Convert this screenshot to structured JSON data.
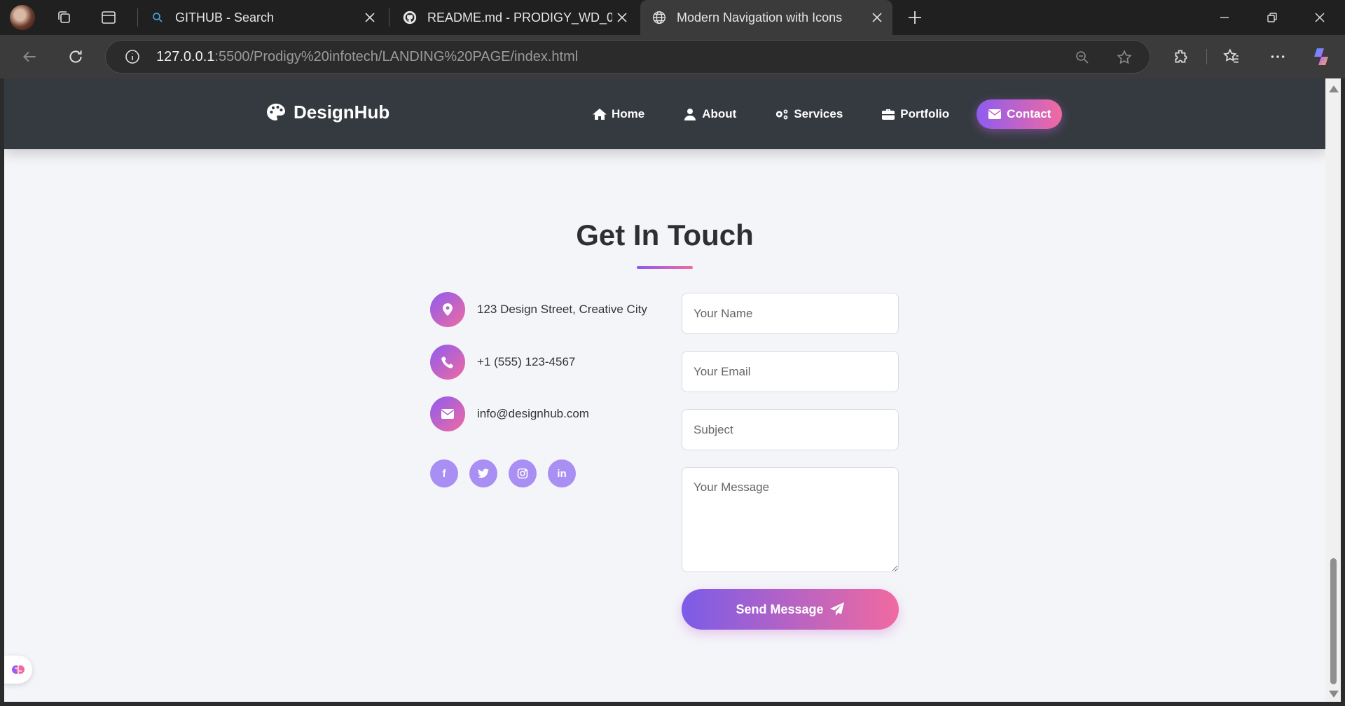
{
  "browser": {
    "tabs": [
      {
        "title": "GITHUB - Search",
        "favicon": "search-icon"
      },
      {
        "title": "README.md - PRODIGY_WD_01 [",
        "favicon": "github-icon"
      },
      {
        "title": "Modern Navigation with Icons",
        "favicon": "globe-icon",
        "active": true
      }
    ],
    "url_host": "127.0.0.1",
    "url_path": ":5500/Prodigy%20infotech/LANDING%20PAGE/index.html"
  },
  "site": {
    "logo": "DesignHub",
    "nav": [
      {
        "label": "Home",
        "icon": "home-icon"
      },
      {
        "label": "About",
        "icon": "user-icon"
      },
      {
        "label": "Services",
        "icon": "gears-icon"
      },
      {
        "label": "Portfolio",
        "icon": "briefcase-icon"
      },
      {
        "label": "Contact",
        "icon": "envelope-icon",
        "active": true
      }
    ]
  },
  "contact": {
    "title": "Get In Touch",
    "info": [
      {
        "icon": "map-pin-icon",
        "text": "123 Design Street, Creative City"
      },
      {
        "icon": "phone-icon",
        "text": "+1 (555) 123-4567"
      },
      {
        "icon": "envelope-icon",
        "text": "info@designhub.com"
      }
    ],
    "socials": [
      {
        "icon": "facebook-icon",
        "glyph": "f"
      },
      {
        "icon": "twitter-icon",
        "glyph": ""
      },
      {
        "icon": "instagram-icon",
        "glyph": ""
      },
      {
        "icon": "linkedin-icon",
        "glyph": "in"
      }
    ],
    "form": {
      "name_placeholder": "Your Name",
      "email_placeholder": "Your Email",
      "subject_placeholder": "Subject",
      "message_placeholder": "Your Message",
      "submit_label": "Send Message"
    }
  },
  "colors": {
    "header_bg": "#343a40",
    "gradient_start": "#8e5cf0",
    "gradient_end": "#f06aa0",
    "page_bg": "#f4f5f9"
  }
}
